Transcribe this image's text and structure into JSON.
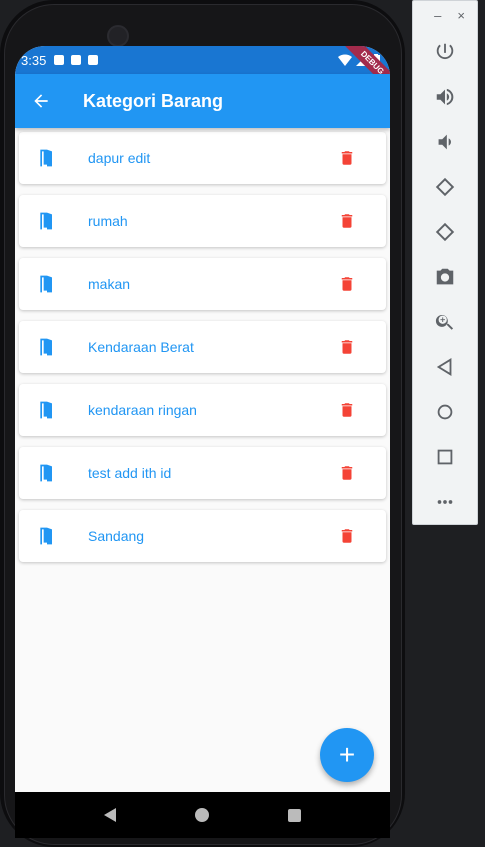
{
  "statusbar": {
    "time": "3:35",
    "debug": "DEBUG"
  },
  "appbar": {
    "title": "Kategori Barang"
  },
  "categories": [
    {
      "name": "dapur edit"
    },
    {
      "name": "rumah"
    },
    {
      "name": "makan"
    },
    {
      "name": "Kendaraan Berat"
    },
    {
      "name": "kendaraan ringan"
    },
    {
      "name": "test add ith id"
    },
    {
      "name": "Sandang"
    }
  ],
  "fab": {
    "label": "+"
  },
  "emulator": {
    "minimize": "–",
    "close": "×",
    "buttons": [
      "power-icon",
      "volume-up-icon",
      "volume-down-icon",
      "rotate-left-icon",
      "rotate-right-icon",
      "camera-icon",
      "zoom-icon",
      "back-icon",
      "home-icon",
      "overview-icon",
      "more-icon"
    ]
  },
  "colors": {
    "primary": "#2196f3",
    "statusbar": "#1976d2",
    "delete": "#f44336"
  }
}
